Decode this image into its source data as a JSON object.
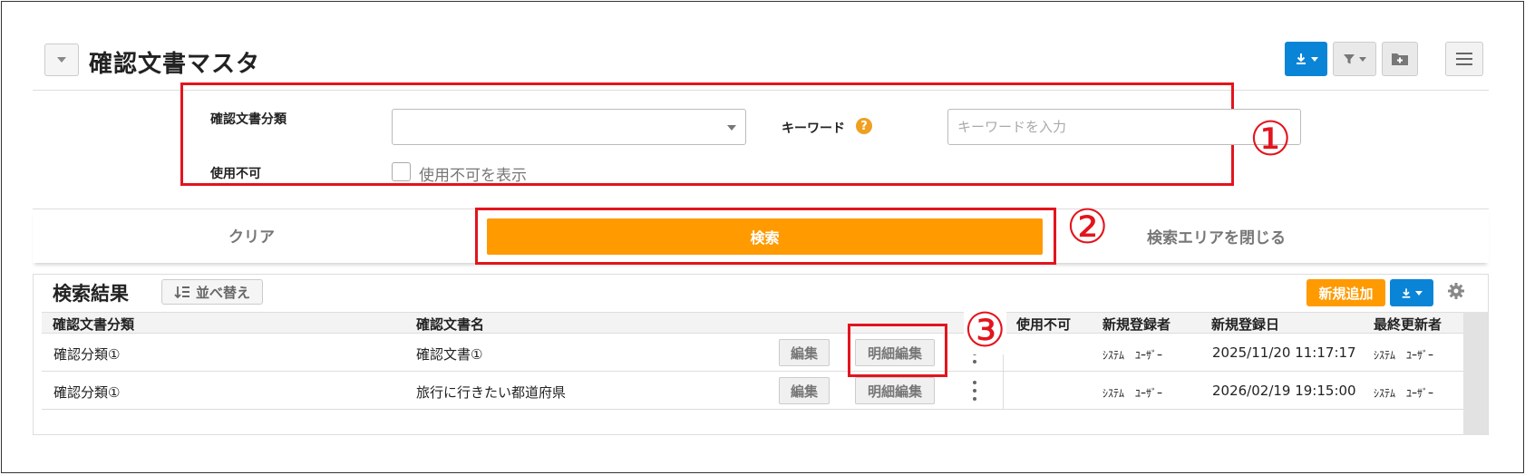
{
  "header": {
    "title": "確認文書マスタ"
  },
  "search": {
    "category_label": "確認文書分類",
    "category_value": "",
    "keyword_label": "キーワード",
    "keyword_placeholder": "キーワードを入力",
    "keyword_value": "",
    "disabled_label": "使用不可",
    "disabled_checkbox_label": "使用不可を表示",
    "disabled_checked": false,
    "clear_label": "クリア",
    "search_label": "検索",
    "close_label": "検索エリアを閉じる"
  },
  "annotations": [
    "①",
    "②",
    "③"
  ],
  "results": {
    "title": "検索結果",
    "sort_label": "並べ替え",
    "new_label": "新規追加",
    "columns": [
      "確認文書分類",
      "確認文書名",
      "使用不可",
      "新規登録者",
      "新規登録日",
      "最終更新者"
    ],
    "rows": [
      {
        "category": "確認分類①",
        "name": "確認文書①",
        "edit": "編集",
        "detail_edit": "明細編集",
        "disabled": "",
        "created_by": "ｼｽﾃﾑ　ﾕｰｻﾞｰ",
        "created_at": "2025/11/20 11:17:17",
        "updated_by": "ｼｽﾃﾑ　ﾕｰｻﾞｰ"
      },
      {
        "category": "確認分類①",
        "name": "旅行に行きたい都道府県",
        "edit": "編集",
        "detail_edit": "明細編集",
        "disabled": "",
        "created_by": "ｼｽﾃﾑ　ﾕｰｻﾞｰ",
        "created_at": "2026/02/19 19:15:00",
        "updated_by": "ｼｽﾃﾑ　ﾕｰｻﾞｰ"
      }
    ]
  },
  "colors": {
    "accent_orange": "#ff9a00",
    "accent_blue": "#0a84d6",
    "annotation_red": "#e3141d"
  },
  "icons": [
    "chevron-down-icon",
    "download-icon",
    "filter-icon",
    "folder-add-icon",
    "hamburger-icon",
    "help-icon",
    "sort-icon",
    "gear-icon",
    "kebab-icon"
  ]
}
